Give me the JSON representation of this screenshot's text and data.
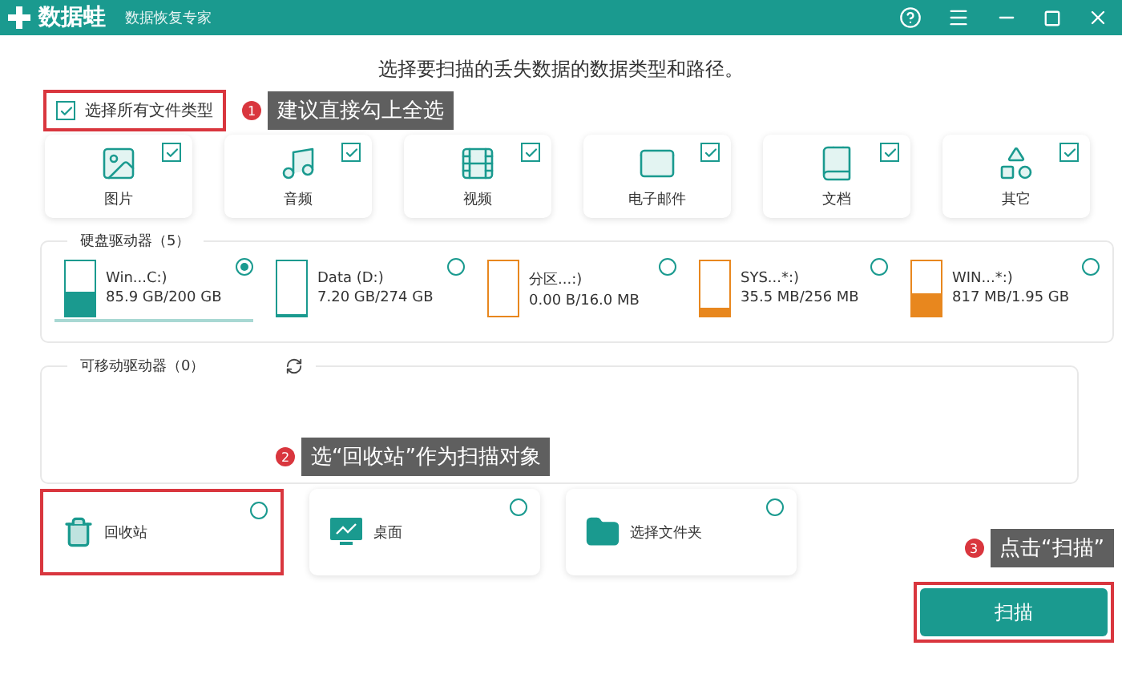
{
  "window": {
    "app_name": "数据蛙",
    "subtitle": "数据恢复专家"
  },
  "heading": "选择要扫描的丢失数据的数据类型和路径。",
  "select_all": {
    "label": "选择所有文件类型",
    "checked": true,
    "highlighted": true,
    "annotation": {
      "number": "1",
      "text": "建议直接勾上全选"
    }
  },
  "file_types": [
    {
      "kind": "image",
      "label": "图片",
      "checked": true
    },
    {
      "kind": "audio",
      "label": "音频",
      "checked": true
    },
    {
      "kind": "video",
      "label": "视频",
      "checked": true
    },
    {
      "kind": "email",
      "label": "电子邮件",
      "checked": true
    },
    {
      "kind": "document",
      "label": "文档",
      "checked": true
    },
    {
      "kind": "other",
      "label": "其它",
      "checked": true
    }
  ],
  "hard_drives": {
    "title": "硬盘驱动器（5）",
    "drives": [
      {
        "name": "Win...C:)",
        "size": "85.9 GB/200 GB",
        "level": 0.43,
        "color": "#1a9a8f",
        "selected": true
      },
      {
        "name": "Data (D:)",
        "size": "7.20 GB/274 GB",
        "level": 0.03,
        "color": "#1a9a8f",
        "selected": false
      },
      {
        "name": "分区...:)",
        "size": "0.00  B/16.0 MB",
        "level": 0,
        "color": "#e8871e",
        "selected": false
      },
      {
        "name": "SYS...*:)",
        "size": "35.5 MB/256 MB",
        "level": 0.14,
        "color": "#e8871e",
        "selected": false
      },
      {
        "name": "WIN...*:)",
        "size": "817 MB/1.95 GB",
        "level": 0.42,
        "color": "#e8871e",
        "selected": false
      }
    ]
  },
  "removable_drives": {
    "title": "可移动驱动器（0）",
    "annotation": {
      "number": "2",
      "text": "选“回收站”作为扫描对象"
    }
  },
  "locations": [
    {
      "kind": "recycle_bin",
      "label": "回收站",
      "selected": false,
      "highlighted": true
    },
    {
      "kind": "desktop",
      "label": "桌面",
      "selected": false,
      "highlighted": false
    },
    {
      "kind": "folder",
      "label": "选择文件夹",
      "selected": false,
      "highlighted": false
    }
  ],
  "scan_button": {
    "label": "扫描",
    "highlighted": true,
    "annotation": {
      "number": "3",
      "text": "点击“扫描”"
    }
  }
}
